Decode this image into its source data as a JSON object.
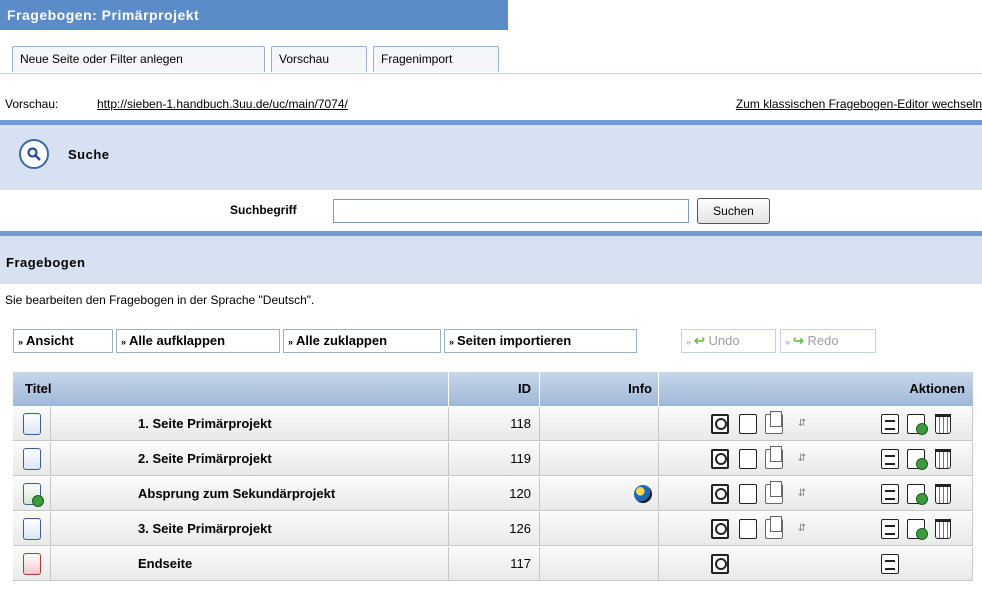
{
  "header": {
    "title": "Fragebogen: Primärprojekt"
  },
  "tabs": [
    {
      "label": "Neue Seite oder Filter anlegen"
    },
    {
      "label": "Vorschau"
    },
    {
      "label": "Fragenimport"
    }
  ],
  "preview": {
    "label": "Vorschau:",
    "url": "http://sieben-1.handbuch.3uu.de/uc/main/7074/",
    "switch_link": "Zum klassischen Fragebogen-Editor wechseln"
  },
  "search": {
    "heading": "Suche",
    "term_label": "Suchbegriff",
    "input_value": "",
    "button_label": "Suchen"
  },
  "questionnaire": {
    "heading": "Fragebogen",
    "language_note": "Sie bearbeiten den Fragebogen in der Sprache \"Deutsch\".",
    "buttons": {
      "view": "Ansicht",
      "expand_all": "Alle aufklappen",
      "collapse_all": "Alle zuklappen",
      "import_pages": "Seiten importieren",
      "undo": "Undo",
      "redo": "Redo"
    },
    "table": {
      "headers": {
        "title": "Titel",
        "id": "ID",
        "info": "Info",
        "actions": "Aktionen"
      },
      "rows": [
        {
          "title": "1. Seite Primärprojekt",
          "id": "118",
          "page_icon": "page-blue-icon",
          "info_icon": ""
        },
        {
          "title": "2. Seite Primärprojekt",
          "id": "119",
          "page_icon": "page-blue-icon",
          "info_icon": ""
        },
        {
          "title": "Absprung zum Sekundärprojekt",
          "id": "120",
          "page_icon": "page-green-icon",
          "info_icon": "globe-icon"
        },
        {
          "title": "3. Seite Primärprojekt",
          "id": "126",
          "page_icon": "page-blue-icon",
          "info_icon": ""
        },
        {
          "title": "Endseite",
          "id": "117",
          "page_icon": "page-red-icon",
          "info_icon": ""
        }
      ]
    }
  }
}
